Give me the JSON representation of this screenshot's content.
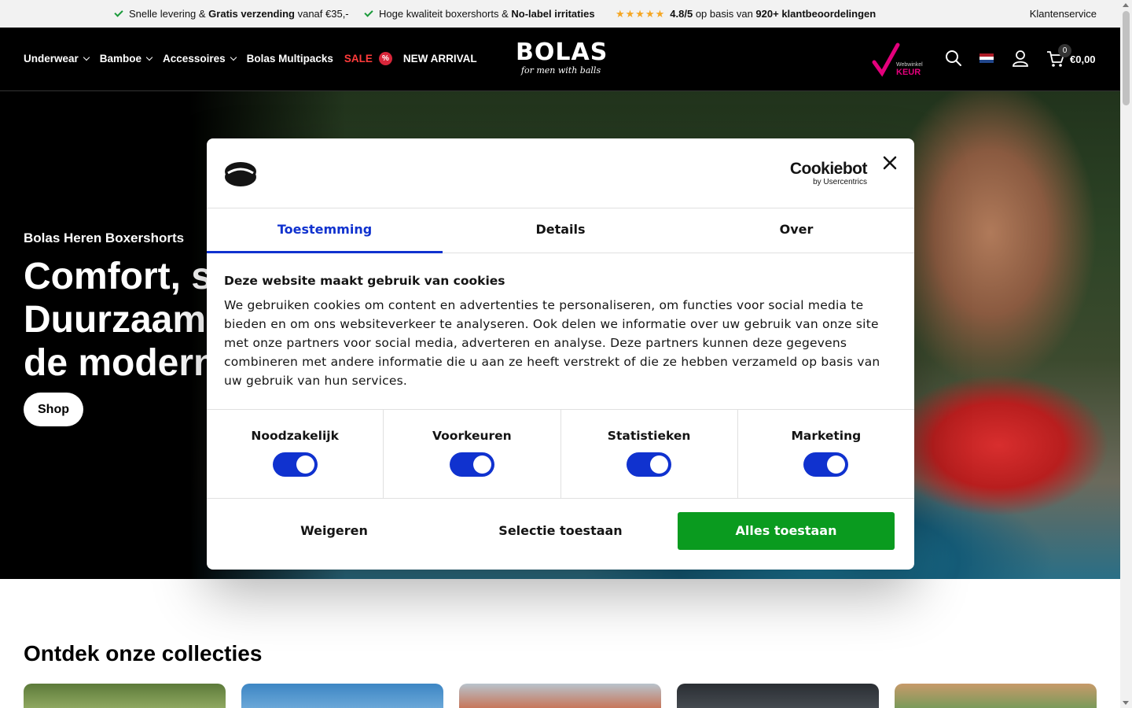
{
  "topbar": {
    "usp1_text": "Snelle levering & ",
    "usp1_bold": "Gratis verzending",
    "usp1_tail": " vanaf €35,-",
    "usp2_text": "Hoge kwaliteit boxershorts & ",
    "usp2_bold": "No-label irritaties",
    "rating_stars": "★★★★★",
    "rating_score": "4.8/5",
    "rating_mid": " op basis van ",
    "rating_bold": "920+ klantbeoordelingen",
    "service_link": "Klantenservice"
  },
  "header": {
    "nav": {
      "underwear": "Underwear",
      "bamboe": "Bamboe",
      "accessoires": "Accessoires",
      "multipacks": "Bolas Multipacks",
      "sale": "SALE",
      "sale_badge": "%",
      "new_arrival": "NEW ARRIVAL"
    },
    "logo_main": "BOLAS",
    "logo_sub": "for men with balls",
    "keur_label": "Webwinkel KEUR",
    "cart_count": "0",
    "cart_total": "€0,00"
  },
  "hero": {
    "kicker": "Bolas Heren Boxershorts",
    "title_line1": "Comfort, s",
    "title_line2": "Duurzaam",
    "title_line3": "de modern",
    "button": "Shop"
  },
  "collections": {
    "title": "Ontdek onze collecties"
  },
  "cookie_dialog": {
    "brand_name": "Cookiebot",
    "brand_by": "by Usercentrics",
    "tabs": [
      "Toestemming",
      "Details",
      "Over"
    ],
    "heading": "Deze website maakt gebruik van cookies",
    "body": "We gebruiken cookies om content en advertenties te personaliseren, om functies voor social media te bieden en om ons websiteverkeer te analyseren. Ook delen we informatie over uw gebruik van onze site met onze partners voor social media, adverteren en analyse. Deze partners kunnen deze gegevens combineren met andere informatie die u aan ze heeft verstrekt of die ze hebben verzameld op basis van uw gebruik van hun services.",
    "toggles": {
      "necessary": "Noodzakelijk",
      "preferences": "Voorkeuren",
      "statistics": "Statistieken",
      "marketing": "Marketing"
    },
    "buttons": {
      "deny": "Weigeren",
      "select": "Selectie toestaan",
      "allow_all": "Alles toestaan"
    }
  },
  "colors": {
    "accent_blue": "#1032cf",
    "allow_green": "#0a9b1f",
    "sale_red": "#ff3b3b"
  }
}
